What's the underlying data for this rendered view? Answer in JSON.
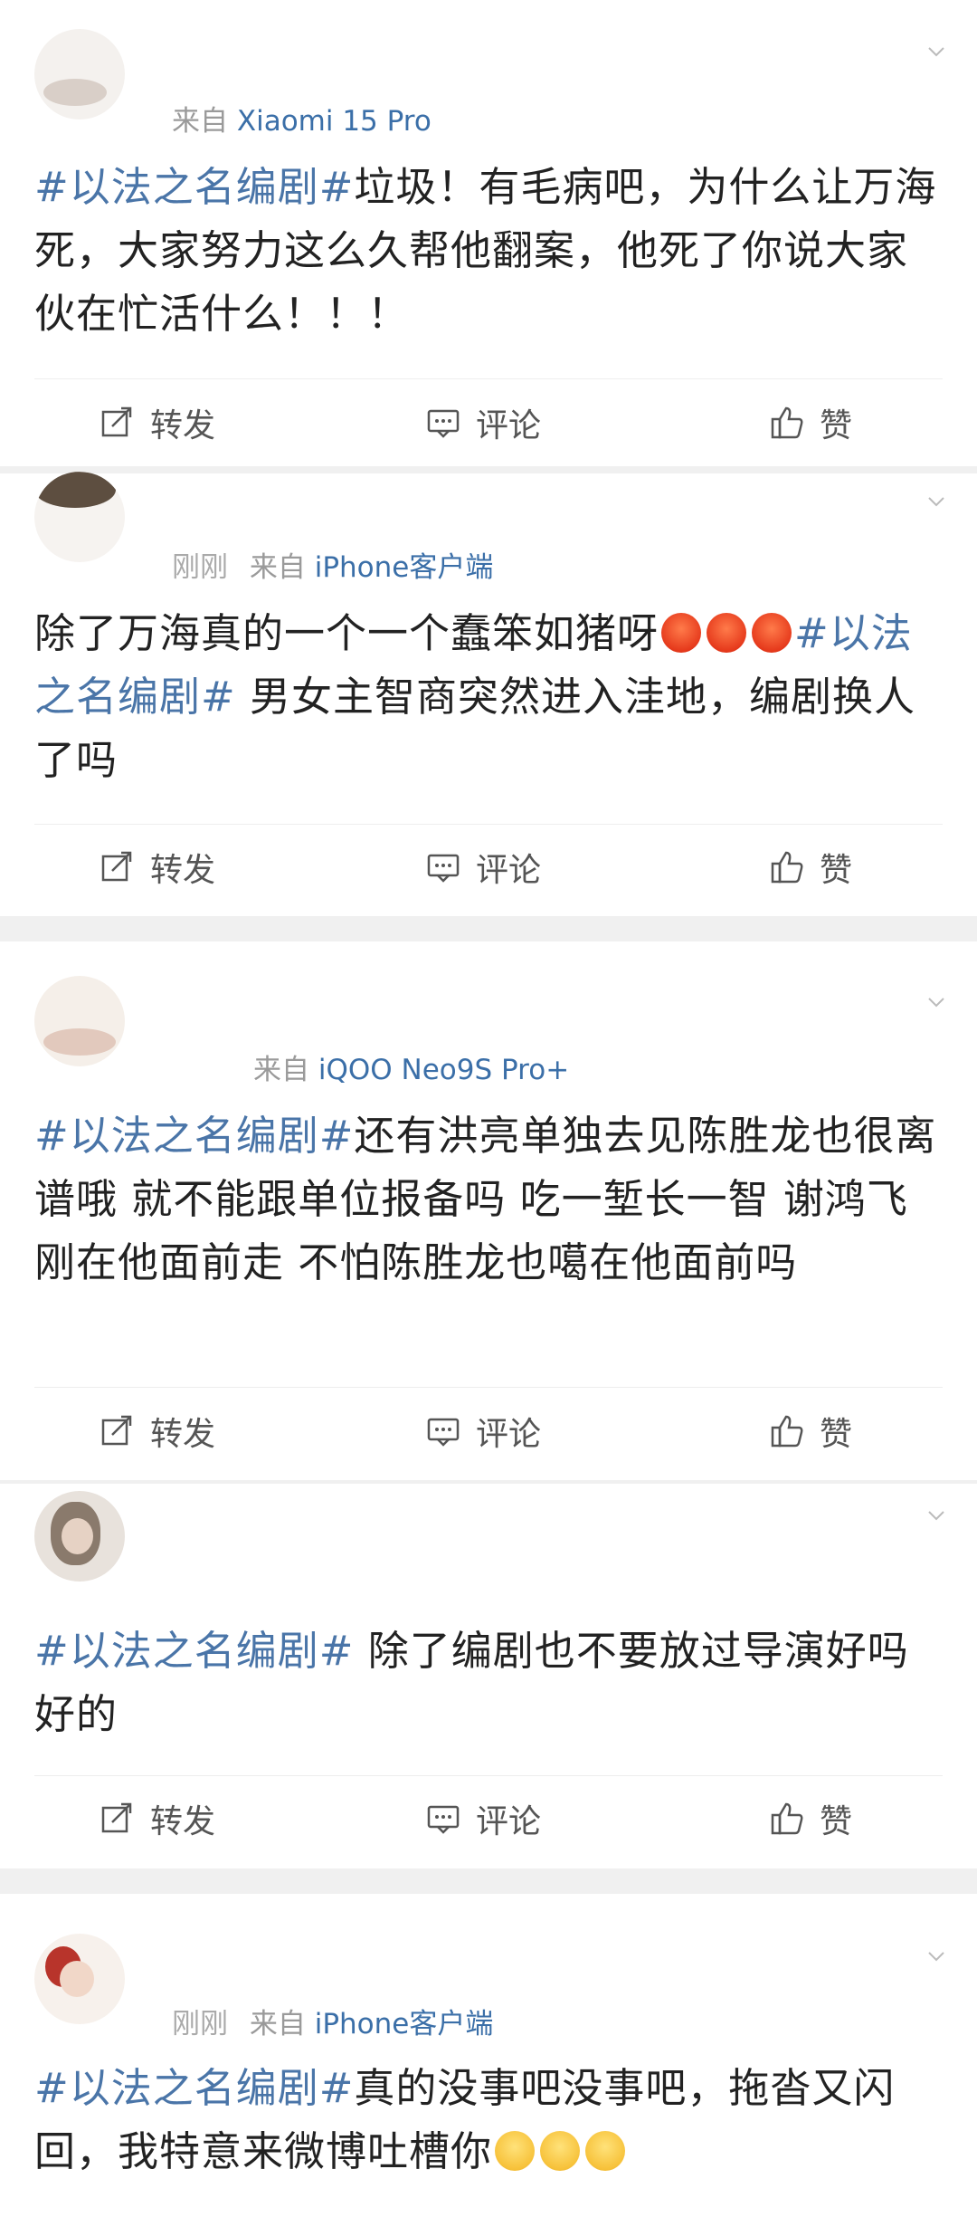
{
  "actions": {
    "repost": "转发",
    "comment": "评论",
    "like": "赞"
  },
  "posts": [
    {
      "source_prefix": "来自",
      "source": "Xiaomi 15 Pro",
      "time": "",
      "tag": "#以法之名编剧#",
      "text": "垃圾！有毛病吧，为什么让万海死，大家努力这么久帮他翻案，他死了你说大家伙在忙活什么！！！"
    },
    {
      "source_prefix": "来自",
      "source": "iPhone客户端",
      "time": "刚刚",
      "text_before": "除了万海真的一个一个蠢笨如猪呀",
      "tag": "#以法之名编剧#",
      "text_after": " 男女主智商突然进入洼地，编剧换人了吗"
    },
    {
      "source_prefix": "来自",
      "source": "iQOO Neo9S Pro+",
      "time": "",
      "tag": "#以法之名编剧#",
      "text": "还有洪亮单独去见陈胜龙也很离谱哦 就不能跟单位报备吗 吃一堑长一智 谢鸿飞刚在他面前走 不怕陈胜龙也噶在他面前吗"
    },
    {
      "source_prefix": "",
      "source": "",
      "time": "",
      "tag": "#以法之名编剧#",
      "text": " 除了编剧也不要放过导演好吗好的"
    },
    {
      "source_prefix": "来自",
      "source": "iPhone客户端",
      "time": "刚刚",
      "tag": "#以法之名编剧#",
      "text": "真的没事吧没事吧，拖沓又闪回，我特意来微博吐槽你"
    }
  ],
  "colors": {
    "tag": "#4a75a8",
    "source": "#3b6fa8",
    "separator": "#f0f0f0"
  },
  "emoji": {
    "angry": "angry-face",
    "smile": "smiling-face"
  }
}
